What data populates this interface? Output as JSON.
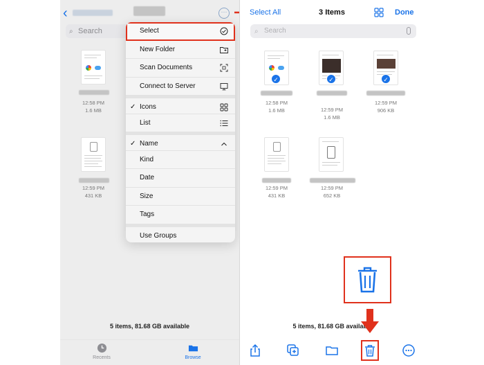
{
  "left": {
    "search_placeholder": "Search",
    "files": [
      {
        "time": "12:58 PM",
        "size": "1.6 MB"
      },
      {
        "time": "12:59 PM",
        "size": "431 KB"
      }
    ],
    "menu": [
      {
        "label": "Select",
        "icon": "checkmark-circle-icon",
        "checked": false
      },
      {
        "label": "New Folder",
        "icon": "folder-plus-icon",
        "checked": false
      },
      {
        "label": "Scan Documents",
        "icon": "scan-doc-icon",
        "checked": false
      },
      {
        "label": "Connect to Server",
        "icon": "monitor-icon",
        "checked": false
      },
      {
        "label": "Icons",
        "icon": "grid-icon",
        "checked": true
      },
      {
        "label": "List",
        "icon": "list-icon",
        "checked": false
      },
      {
        "label": "Name",
        "icon": "chevron-up-icon",
        "checked": true
      },
      {
        "label": "Kind",
        "icon": "",
        "checked": false
      },
      {
        "label": "Date",
        "icon": "",
        "checked": false
      },
      {
        "label": "Size",
        "icon": "",
        "checked": false
      },
      {
        "label": "Tags",
        "icon": "",
        "checked": false
      },
      {
        "label": "Use Groups",
        "icon": "",
        "checked": false
      }
    ],
    "footer": "5 items, 81.68 GB available",
    "tabs": {
      "recents": "Recents",
      "browse": "Browse"
    }
  },
  "right": {
    "select_all": "Select All",
    "title": "3 Items",
    "done": "Done",
    "search_placeholder": "Search",
    "files": [
      {
        "time": "12:58 PM",
        "size": "1.6 MB",
        "selected": true
      },
      {
        "time": "12:59 PM",
        "size": "1.6 MB",
        "selected": true
      },
      {
        "time": "12:59 PM",
        "size": "906 KB",
        "selected": true
      },
      {
        "time": "12:59 PM",
        "size": "431 KB",
        "selected": false
      },
      {
        "time": "12:59 PM",
        "size": "652 KB",
        "selected": false
      }
    ],
    "footer": "5 items, 81.68 GB available"
  },
  "colors": {
    "accent": "#1a73e8",
    "annotation_red": "#e0311c"
  }
}
